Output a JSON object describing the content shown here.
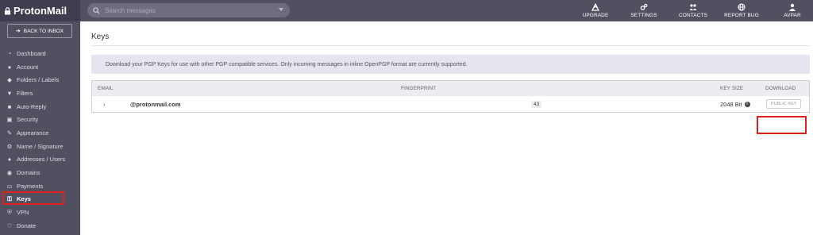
{
  "app": {
    "logo_text": "ProtonMail"
  },
  "search": {
    "placeholder": "Search messages"
  },
  "top_nav": [
    {
      "label": "UPGRADE",
      "icon": "upgrade-icon"
    },
    {
      "label": "SETTINGS",
      "icon": "gears-icon"
    },
    {
      "label": "CONTACTS",
      "icon": "contacts-icon"
    },
    {
      "label": "REPORT BUG",
      "icon": "globe-icon"
    },
    {
      "label": "AVPAR",
      "icon": "user-icon"
    }
  ],
  "sidebar": {
    "back_label": "BACK TO INBOX",
    "items": [
      {
        "label": "Dashboard",
        "icon": "dashboard-icon"
      },
      {
        "label": "Account",
        "icon": "user-icon"
      },
      {
        "label": "Folders / Labels",
        "icon": "tag-icon"
      },
      {
        "label": "Filters",
        "icon": "filter-icon"
      },
      {
        "label": "Auto-Reply",
        "icon": "folder-icon"
      },
      {
        "label": "Security",
        "icon": "lock-icon"
      },
      {
        "label": "Appearance",
        "icon": "brush-icon"
      },
      {
        "label": "Name / Signature",
        "icon": "gear-icon"
      },
      {
        "label": "Addresses / Users",
        "icon": "users-icon"
      },
      {
        "label": "Domains",
        "icon": "globe-icon"
      },
      {
        "label": "Payments",
        "icon": "card-icon"
      },
      {
        "label": "Keys",
        "icon": "key-icon",
        "active": true
      },
      {
        "label": "VPN",
        "icon": "shield-icon"
      },
      {
        "label": "Donate",
        "icon": "heart-icon"
      }
    ]
  },
  "main": {
    "title": "Keys",
    "alert": "Download your PGP Keys for use with other PGP compatible services. Only incoming messages in inline OpenPGP format are currently supported.",
    "table": {
      "headers": {
        "email": "EMAIL",
        "fingerprint": "FINGERPRINT",
        "key_size": "KEY SIZE",
        "download": "DOWNLOAD"
      },
      "rows": [
        {
          "email": "@protonmail.com",
          "fingerprint": "43",
          "key_size": "2048 Bit",
          "download_label": "PUBLIC KEY"
        }
      ]
    }
  },
  "colors": {
    "sidebar_bg": "#505061",
    "highlight": "#e0201f",
    "alert_bg": "#e5e5ef"
  }
}
